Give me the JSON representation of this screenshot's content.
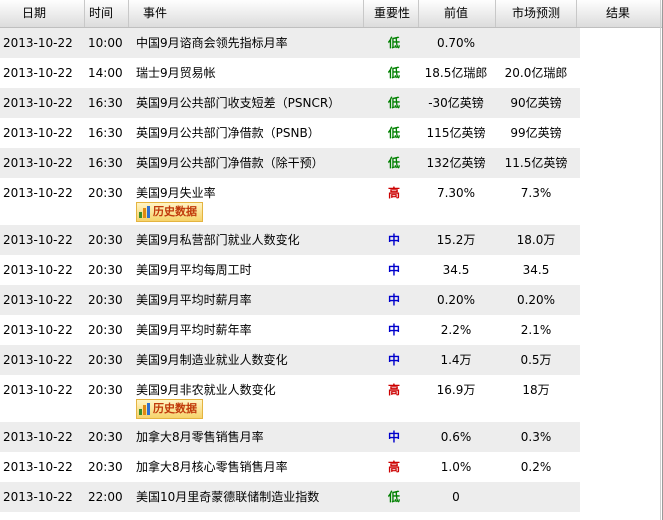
{
  "header": {
    "date": "日期",
    "time": "时间",
    "event": "事件",
    "importance": "重要性",
    "previous": "前值",
    "forecast": "市场预测",
    "result": "结果"
  },
  "history_button_label": "历史数据",
  "rows": [
    {
      "date": "2013-10-22",
      "time": "10:00",
      "event": "中国9月谘商会领先指标月率",
      "importance": "低",
      "previous": "0.70%",
      "forecast": "",
      "result": ""
    },
    {
      "date": "2013-10-22",
      "time": "14:00",
      "event": "瑞士9月贸易帐",
      "importance": "低",
      "previous": "18.5亿瑞郎",
      "forecast": "20.0亿瑞郎",
      "result": ""
    },
    {
      "date": "2013-10-22",
      "time": "16:30",
      "event": "英国9月公共部门收支短差（PSNCR）",
      "importance": "低",
      "previous": "-30亿英镑",
      "forecast": "90亿英镑",
      "result": ""
    },
    {
      "date": "2013-10-22",
      "time": "16:30",
      "event": "英国9月公共部门净借款（PSNB）",
      "importance": "低",
      "previous": "115亿英镑",
      "forecast": "99亿英镑",
      "result": ""
    },
    {
      "date": "2013-10-22",
      "time": "16:30",
      "event": "英国9月公共部门净借款（除干预）",
      "importance": "低",
      "previous": "132亿英镑",
      "forecast": "11.5亿英镑",
      "result": ""
    },
    {
      "date": "2013-10-22",
      "time": "20:30",
      "event": "美国9月失业率",
      "importance": "高",
      "previous": "7.30%",
      "forecast": "7.3%",
      "result": "",
      "history": true
    },
    {
      "date": "2013-10-22",
      "time": "20:30",
      "event": "美国9月私营部门就业人数变化",
      "importance": "中",
      "previous": "15.2万",
      "forecast": "18.0万",
      "result": ""
    },
    {
      "date": "2013-10-22",
      "time": "20:30",
      "event": "美国9月平均每周工时",
      "importance": "中",
      "previous": "34.5",
      "forecast": "34.5",
      "result": ""
    },
    {
      "date": "2013-10-22",
      "time": "20:30",
      "event": "美国9月平均时薪月率",
      "importance": "中",
      "previous": "0.20%",
      "forecast": "0.20%",
      "result": ""
    },
    {
      "date": "2013-10-22",
      "time": "20:30",
      "event": "美国9月平均时薪年率",
      "importance": "中",
      "previous": "2.2%",
      "forecast": "2.1%",
      "result": ""
    },
    {
      "date": "2013-10-22",
      "time": "20:30",
      "event": "美国9月制造业就业人数变化",
      "importance": "中",
      "previous": "1.4万",
      "forecast": "0.5万",
      "result": ""
    },
    {
      "date": "2013-10-22",
      "time": "20:30",
      "event": "美国9月非农就业人数变化",
      "importance": "高",
      "previous": "16.9万",
      "forecast": "18万",
      "result": "",
      "history": true
    },
    {
      "date": "2013-10-22",
      "time": "20:30",
      "event": "加拿大8月零售销售月率",
      "importance": "中",
      "previous": "0.6%",
      "forecast": "0.3%",
      "result": ""
    },
    {
      "date": "2013-10-22",
      "time": "20:30",
      "event": "加拿大8月核心零售销售月率",
      "importance": "高",
      "previous": "1.0%",
      "forecast": "0.2%",
      "result": ""
    },
    {
      "date": "2013-10-22",
      "time": "22:00",
      "event": "美国10月里奇蒙德联储制造业指数",
      "importance": "低",
      "previous": "0",
      "forecast": "",
      "result": ""
    }
  ],
  "importance_colors": {
    "低": "#008000",
    "中": "#0000cc",
    "高": "#cc0000"
  }
}
